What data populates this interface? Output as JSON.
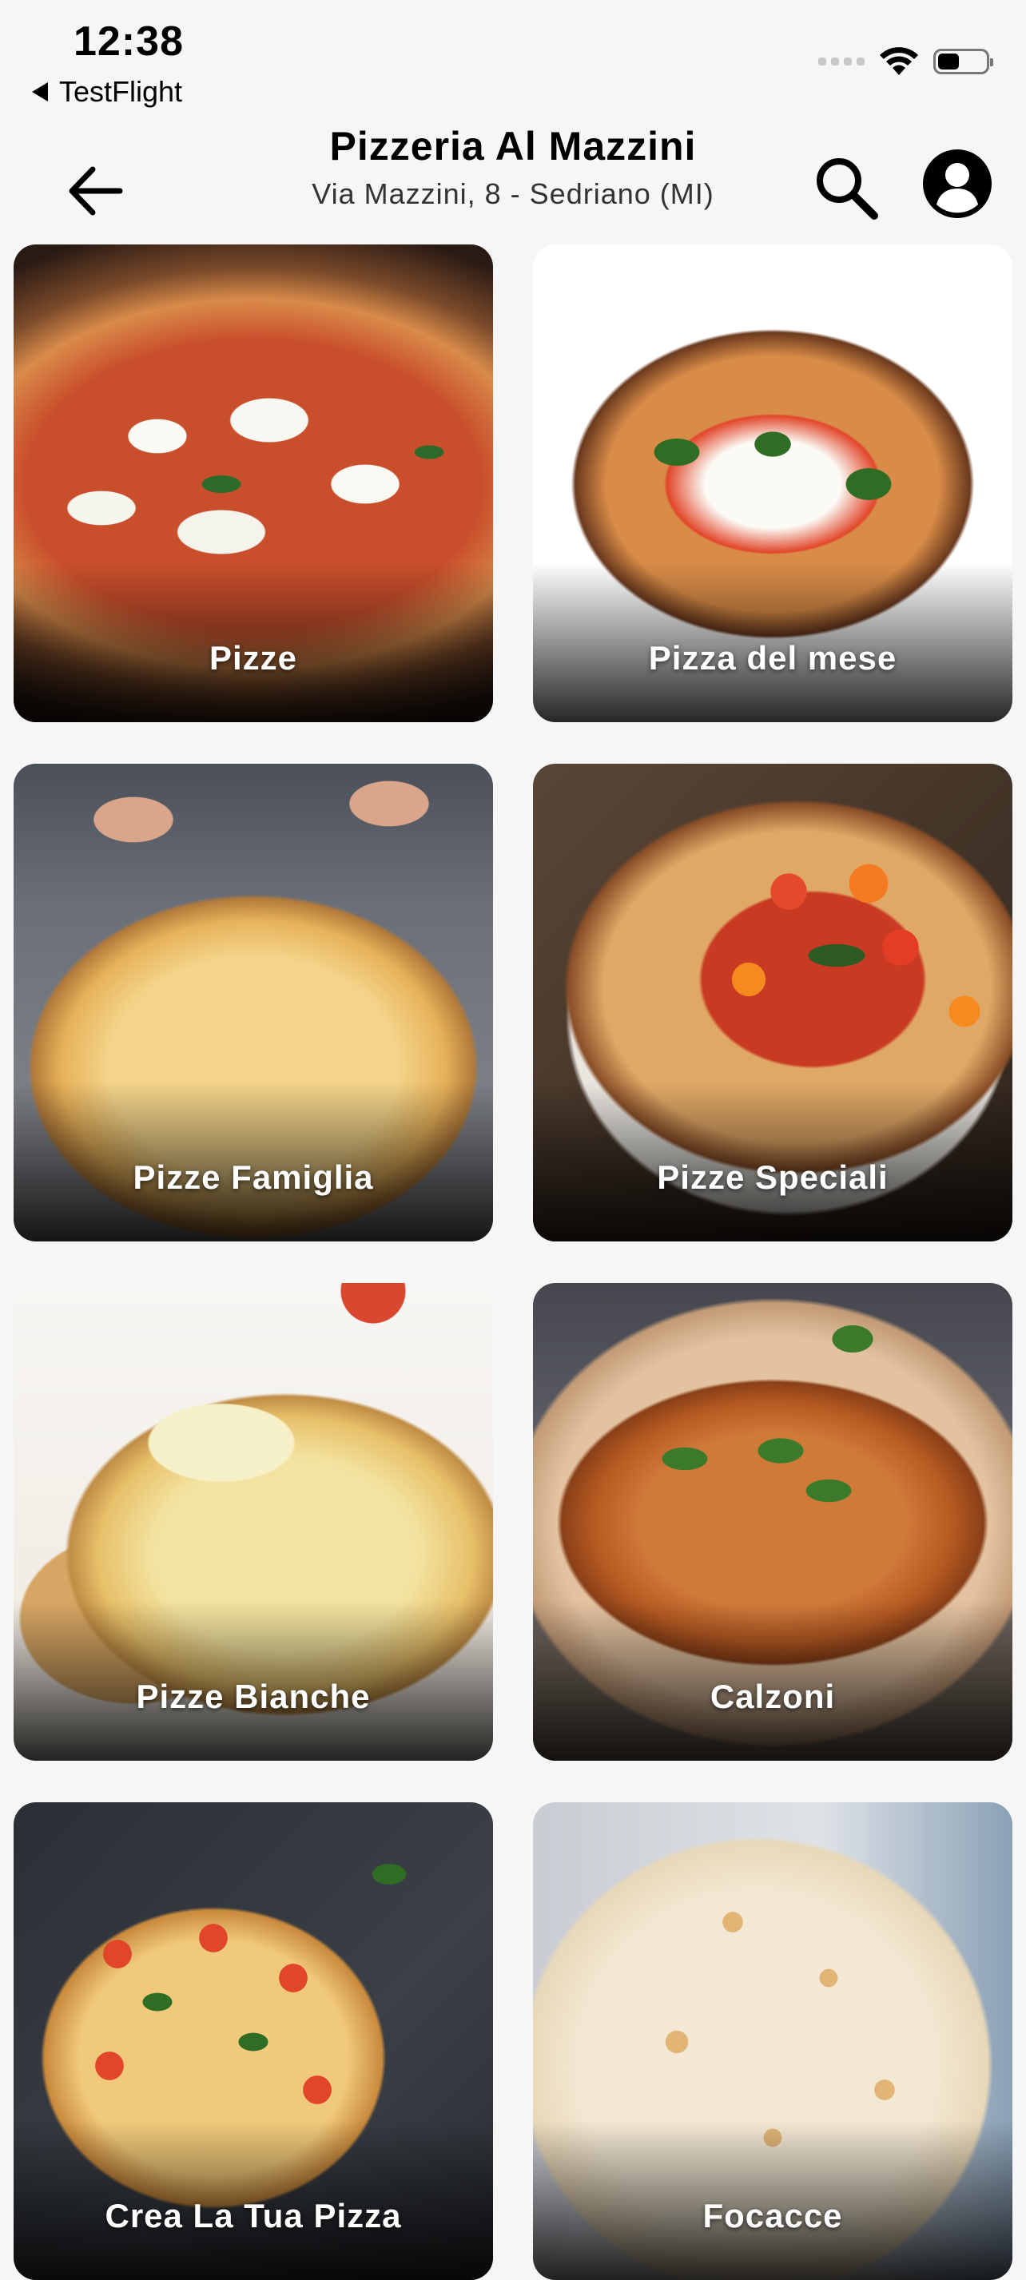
{
  "status_bar": {
    "time": "12:38",
    "back_app": "TestFlight"
  },
  "header": {
    "title": "Pizzeria Al Mazzini",
    "subtitle": "Via Mazzini, 8 - Sedriano (MI)",
    "back_icon": "arrow-left-icon",
    "search_icon": "search-icon",
    "account_icon": "account-icon"
  },
  "categories": [
    {
      "label": "Pizze"
    },
    {
      "label": "Pizza del mese"
    },
    {
      "label": "Pizze Famiglia"
    },
    {
      "label": "Pizze Speciali"
    },
    {
      "label": "Pizze Bianche"
    },
    {
      "label": "Calzoni"
    },
    {
      "label": "Crea La Tua Pizza"
    },
    {
      "label": "Focacce"
    }
  ]
}
